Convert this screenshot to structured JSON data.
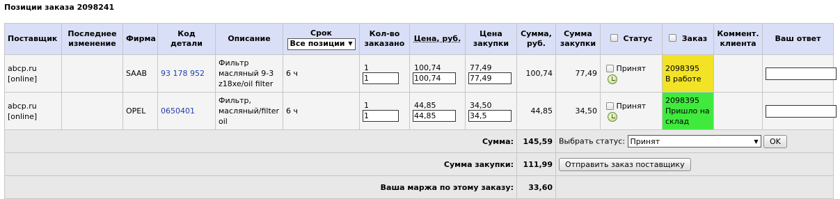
{
  "page_title": "Позиции заказа 2098241",
  "headers": {
    "supplier": "Поставщик",
    "last_change": "Последнее изменение",
    "brand": "Фирма",
    "part_code": "Код детали",
    "description": "Описание",
    "term": "Срок",
    "term_filter": "Все позиции",
    "qty": "Кол-во заказано",
    "price": "Цена, руб.",
    "purchase_price": "Цена закупки",
    "sum": "Сумма, руб.",
    "purchase_sum": "Сумма закупки",
    "status": "Статус",
    "order": "Заказ",
    "comment": "Коммент. клиента",
    "answer": "Ваш ответ"
  },
  "rows": [
    {
      "supplier": "abcp.ru [online]",
      "last_change": "",
      "brand": "SAAB",
      "part_code": "93 178 952",
      "description": "Фильтр масляный 9-3 z18xe/oil filter",
      "term": "6 ч",
      "qty": "1",
      "qty_input": "1",
      "price": "100,74",
      "price_input": "100,74",
      "purchase_price": "77,49",
      "purchase_input": "77,49",
      "sum": "100,74",
      "purchase_sum": "77,49",
      "status": "Принят",
      "order_number": "2098395",
      "order_status": "В работе",
      "order_color": "#f2e327",
      "comment": "",
      "answer": ""
    },
    {
      "supplier": "abcp.ru [online]",
      "last_change": "",
      "brand": "OPEL",
      "part_code": "0650401",
      "description": "Фильтр, масляный/filter oil",
      "term": "6 ч",
      "qty": "1",
      "qty_input": "1",
      "price": "44,85",
      "price_input": "44,85",
      "purchase_price": "34,50",
      "purchase_input": "34,5",
      "sum": "44,85",
      "purchase_sum": "34,50",
      "status": "Принят",
      "order_number": "2098395",
      "order_status": "Пришло на склад",
      "order_color": "#40ea3d",
      "comment": "",
      "answer": ""
    }
  ],
  "summary": {
    "sum_label": "Сумма:",
    "sum_value": "145,59",
    "choose_status_label": "Выбрать статус:",
    "choose_status_value": "Принят",
    "ok_button": "OK",
    "purchase_sum_label": "Сумма закупки:",
    "purchase_sum_value": "111,99",
    "send_button": "Отправить заказ поставщику",
    "margin_label": "Ваша маржа по этому заказу:",
    "margin_value": "33,60"
  },
  "icons": {
    "status_history": "history-icon",
    "dropdown": "chevron-down-icon"
  }
}
